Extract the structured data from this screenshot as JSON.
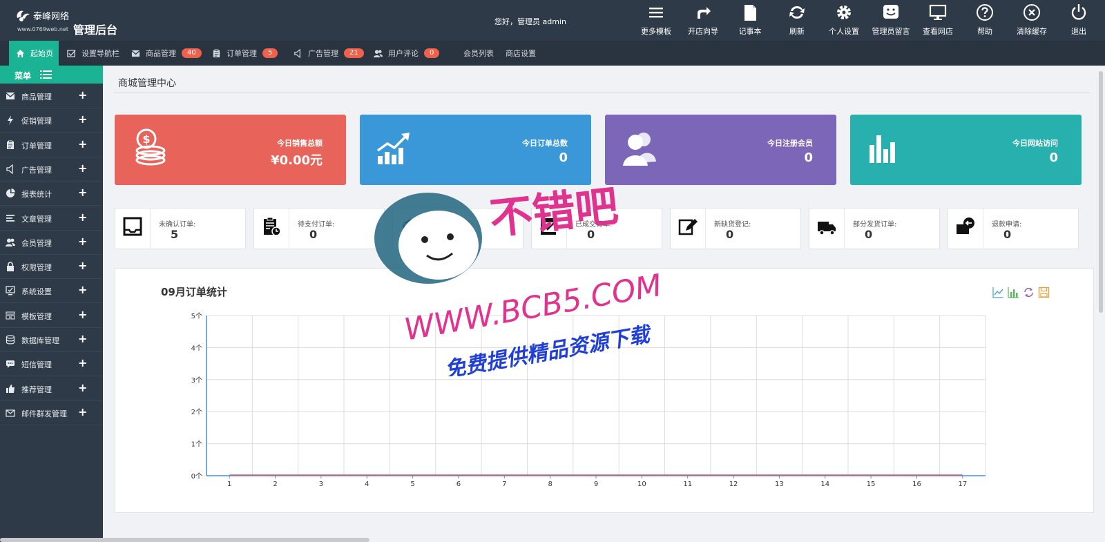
{
  "header": {
    "brand_name": "泰峰网络",
    "brand_url": "www.0769web.net",
    "brand_admin": "管理后台",
    "greeting": "您好，管理员 admin",
    "tools": [
      {
        "label": "更多模板",
        "icon": "menu-icon"
      },
      {
        "label": "开店向导",
        "icon": "share-arrow-icon"
      },
      {
        "label": "记事本",
        "icon": "notepad-icon"
      },
      {
        "label": "刷新",
        "icon": "refresh-icon"
      },
      {
        "label": "个人设置",
        "icon": "gear-icon"
      },
      {
        "label": "管理员留言",
        "icon": "smile-message-icon"
      },
      {
        "label": "查看网店",
        "icon": "monitor-icon"
      },
      {
        "label": "帮助",
        "icon": "help-icon"
      },
      {
        "label": "清除缓存",
        "icon": "clear-cache-icon"
      },
      {
        "label": "退出",
        "icon": "power-icon"
      }
    ]
  },
  "navbar": {
    "items": [
      {
        "label": "起始页",
        "icon": "home-icon",
        "active": true
      },
      {
        "label": "设置导航栏",
        "icon": "checkbox-icon"
      },
      {
        "label": "商品管理",
        "icon": "mail-icon",
        "badge": "40"
      },
      {
        "label": "订单管理",
        "icon": "clipboard-icon",
        "badge": "5"
      },
      {
        "label": "广告管理",
        "icon": "speaker-icon",
        "badge": "21"
      },
      {
        "label": "用户评论",
        "icon": "users-icon",
        "badge": "0"
      },
      {
        "label": "会员列表"
      },
      {
        "label": "商店设置"
      }
    ]
  },
  "sidebar": {
    "header": "菜单",
    "items": [
      {
        "label": "商品管理",
        "icon": "mail-icon"
      },
      {
        "label": "促销管理",
        "icon": "bolt-icon"
      },
      {
        "label": "订单管理",
        "icon": "clipboard-icon"
      },
      {
        "label": "广告管理",
        "icon": "speaker-icon"
      },
      {
        "label": "报表统计",
        "icon": "pie-chart-icon"
      },
      {
        "label": "文章管理",
        "icon": "align-left-icon"
      },
      {
        "label": "会员管理",
        "icon": "users-icon"
      },
      {
        "label": "权限管理",
        "icon": "lock-icon"
      },
      {
        "label": "系统设置",
        "icon": "monitor-check-icon"
      },
      {
        "label": "模板管理",
        "icon": "template-icon"
      },
      {
        "label": "数据库管理",
        "icon": "database-icon"
      },
      {
        "label": "短信管理",
        "icon": "chat-icon"
      },
      {
        "label": "推荐管理",
        "icon": "thumbs-up-icon"
      },
      {
        "label": "邮件群发管理",
        "icon": "envelope-icon"
      }
    ]
  },
  "main": {
    "title": "商城管理中心",
    "stats": [
      {
        "label": "今日销售总额",
        "value": "¥0.00元",
        "color": "#e8645a",
        "icon": "coins-icon"
      },
      {
        "label": "今日订单总数",
        "value": "0",
        "color": "#3a98d8",
        "icon": "trend-up-icon"
      },
      {
        "label": "今日注册会员",
        "value": "0",
        "color": "#7b66b8",
        "icon": "members-icon"
      },
      {
        "label": "今日网站访问",
        "value": "0",
        "color": "#27b0ad",
        "icon": "bar-chart-icon"
      }
    ],
    "minis": [
      {
        "label": "未确认订单:",
        "value": "5",
        "icon": "inbox-icon"
      },
      {
        "label": "待支付订单:",
        "value": "0",
        "icon": "clipboard-clock-icon"
      },
      {
        "label": "待发货订单:",
        "value": "0",
        "icon": "shipping-box-icon"
      },
      {
        "label": "已成交订单:",
        "value": "0",
        "icon": "checklist-icon"
      },
      {
        "label": "新缺货登记:",
        "value": "0",
        "icon": "edit-icon"
      },
      {
        "label": "部分发货订单:",
        "value": "0",
        "icon": "truck-icon"
      },
      {
        "label": "退款申请:",
        "value": "0",
        "icon": "refund-icon"
      }
    ],
    "chart_tools": [
      "line-chart-icon",
      "bar-chart-icon",
      "restore-icon",
      "save-icon"
    ]
  },
  "chart_data": {
    "type": "line",
    "title": "09月订单统计",
    "x": [
      1,
      2,
      3,
      4,
      5,
      6,
      7,
      8,
      9,
      10,
      11,
      12,
      13,
      14,
      15,
      16,
      17
    ],
    "series": [
      {
        "values": [
          0,
          0,
          0,
          0,
          0,
          0,
          0,
          0,
          0,
          0,
          0,
          0,
          0,
          0,
          0,
          0,
          0
        ]
      }
    ],
    "yticks": [
      "0个",
      "1个",
      "2个",
      "3个",
      "4个",
      "5个"
    ],
    "ylim": [
      0,
      5
    ],
    "grid": true,
    "colors": {
      "axis": "#4a90d9",
      "line": "#e05b5b"
    }
  },
  "watermark": {
    "line1": "不错吧",
    "line2": "WWW.BCB5.COM",
    "line3": "免费提供精品资源下载"
  }
}
